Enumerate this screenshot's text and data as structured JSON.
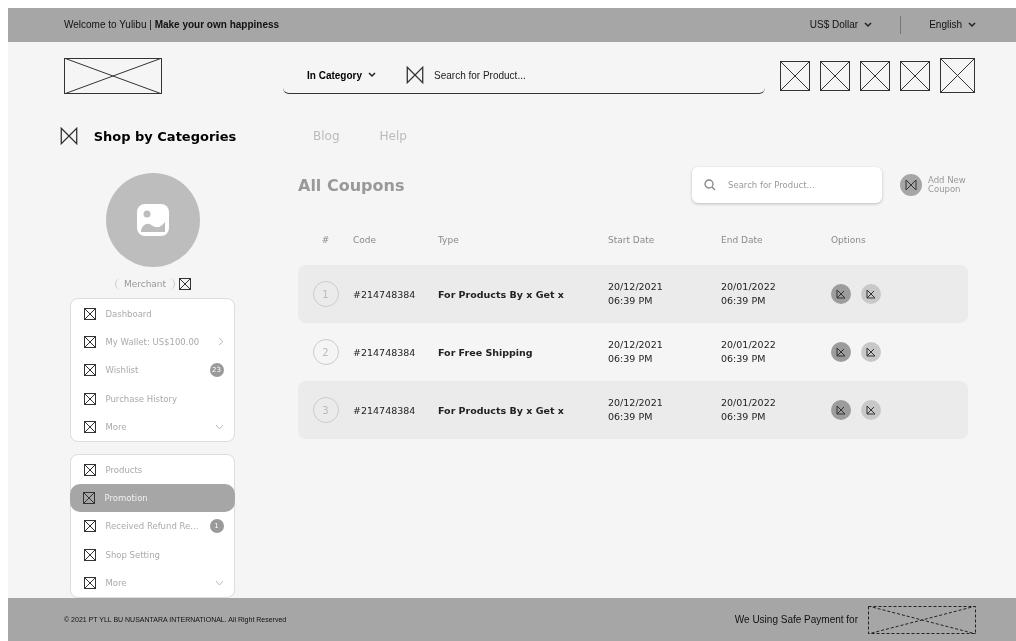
{
  "top_bar": {
    "welcome": "Welcome to Yulibu | **Make your own happiness**",
    "currency": "US$ Dollar",
    "language": "English"
  },
  "search_bar": {
    "category": "In Category",
    "placeholder": "Search for Product..."
  },
  "nav": {
    "categories": "Shop by Categories",
    "links": [
      "Blog",
      "Help"
    ]
  },
  "profile": {
    "role": "Merchant"
  },
  "menu_groups": [
    {
      "items": [
        {
          "label": "Dashboard",
          "selected": false
        },
        {
          "label": "My Wallet: US$100.00",
          "selected": false,
          "kind": "arrow"
        },
        {
          "label": "Wishlist",
          "selected": false,
          "badge": "23"
        },
        {
          "label": "Purchase History",
          "selected": false
        },
        {
          "label": "More",
          "selected": false,
          "kind": "expand"
        }
      ]
    },
    {
      "items": [
        {
          "label": "Products",
          "selected": false
        },
        {
          "label": "Promotion",
          "selected": true
        },
        {
          "label": "Received Refund Re...",
          "selected": false,
          "badge": "1"
        },
        {
          "label": "Shop Setting",
          "selected": false
        },
        {
          "label": "More",
          "selected": false,
          "kind": "expand"
        }
      ]
    }
  ],
  "coupons": {
    "title": "All Coupons",
    "search_placeholder": "Search for Product...",
    "add_button": "Add New Coupon",
    "columns": [
      "#",
      "Code",
      "Type",
      "Start Date",
      "End Date",
      "Options"
    ],
    "rows": [
      {
        "number": "1",
        "code": "#214748384",
        "type": "For Products By x Get x",
        "start_date": "20/12/2021",
        "start_time": "06:39 PM",
        "end_date": "20/01/2022",
        "end_time": "06:39 PM"
      },
      {
        "number": "2",
        "code": "#214748384",
        "type": "For Free Shipping",
        "start_date": "20/12/2021",
        "start_time": "06:39 PM",
        "end_date": "20/01/2022",
        "end_time": "06:39 PM"
      },
      {
        "number": "3",
        "code": "#214748384",
        "type": "For Products By x Get x",
        "start_date": "20/12/2021",
        "start_time": "06:39 PM",
        "end_date": "20/01/2022",
        "end_time": "06:39 PM"
      }
    ]
  },
  "footer": {
    "copyright": "© 2021 PT YLL BU NUSANTARA INTERNATIONAL. All Right Reserved",
    "payment": "We Using Safe Payment for"
  }
}
